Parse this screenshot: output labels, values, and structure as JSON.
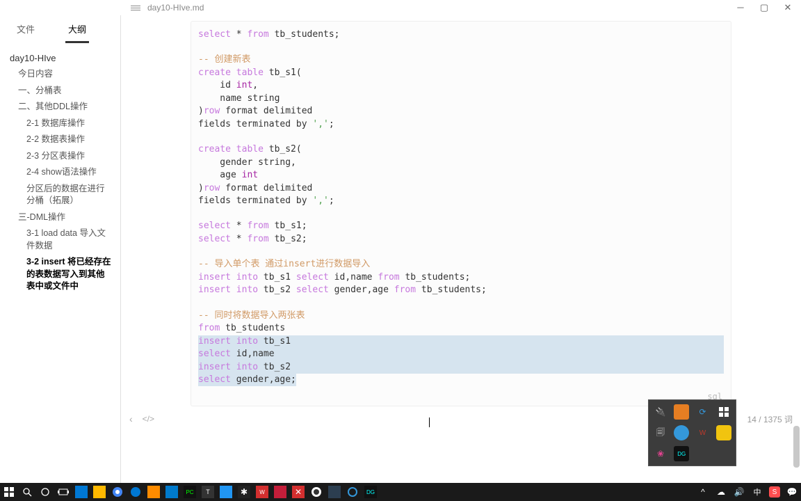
{
  "titlebar": {
    "filename": "day10-HIve.md"
  },
  "side_tabs": {
    "files": "文件",
    "outline": "大纲"
  },
  "outline": {
    "doc": "day10-HIve",
    "items": [
      {
        "label": "今日内容",
        "lvl": 1
      },
      {
        "label": "一、分桶表",
        "lvl": 1
      },
      {
        "label": "二、其他DDL操作",
        "lvl": 1
      },
      {
        "label": "2-1 数据库操作",
        "lvl": 2
      },
      {
        "label": "2-2 数据表操作",
        "lvl": 2
      },
      {
        "label": "2-3 分区表操作",
        "lvl": 2
      },
      {
        "label": "2-4 show语法操作",
        "lvl": 2
      },
      {
        "label": "分区后的数据在进行分桶（拓展）",
        "lvl": 2
      },
      {
        "label": "三-DML操作",
        "lvl": 1
      },
      {
        "label": "3-1 load data 导入文件数据",
        "lvl": 2
      },
      {
        "label": "3-2 insert 将已经存在的表数据写入到其他表中或文件中",
        "lvl": 2,
        "bold": true
      }
    ]
  },
  "code": {
    "lang": "sql",
    "c01a": "select",
    "c01b": " * ",
    "c01c": "from",
    "c01d": " tb_students;",
    "c03a": "-- ",
    "c03b": "创建新表",
    "c04a": "create table",
    "c04b": " tb_s1(",
    "c05a": "    id ",
    "c05b": "int",
    "c05c": ",",
    "c06a": "    name string",
    "c07a": ")",
    "c07b": "row",
    "c07c": " format delimited",
    "c08a": "fields terminated by ",
    "c08b": "','",
    "c08c": ";",
    "c10a": "create table",
    "c10b": " tb_s2(",
    "c11a": "    gender string,",
    "c12a": "    age ",
    "c12b": "int",
    "c13a": ")",
    "c13b": "row",
    "c13c": " format delimited",
    "c14a": "fields terminated by ",
    "c14b": "','",
    "c14c": ";",
    "c16a": "select",
    "c16b": " * ",
    "c16c": "from",
    "c16d": " tb_s1;",
    "c17a": "select",
    "c17b": " * ",
    "c17c": "from",
    "c17d": " tb_s2;",
    "c19a": "-- ",
    "c19b": "导入单个表 通过insert进行数据导入",
    "c20a": "insert into",
    "c20b": " tb_s1 ",
    "c20c": "select",
    "c20d": " id,name ",
    "c20e": "from",
    "c20f": " tb_students;",
    "c21a": "insert into",
    "c21b": " tb_s2 ",
    "c21c": "select",
    "c21d": " gender,age ",
    "c21e": "from",
    "c21f": " tb_students;",
    "c23a": "-- ",
    "c23b": "同时将数据导入两张表",
    "c24a": "from",
    "c24b": " tb_students",
    "c25a": "insert into",
    "c25b": " tb_s1",
    "c26a": "select",
    "c26b": " id,name",
    "c27a": "insert into",
    "c27b": " tb_s2",
    "c28a": "select",
    "c28b": " gender,age;"
  },
  "status": {
    "words": "14 / 1375 词"
  },
  "tray": {
    "colors": [
      "#888",
      "#e67e22",
      "#3498db",
      "#fff",
      "#888",
      "#3498db",
      "#c0392b",
      "#f1c40f",
      "#e84393",
      "#333"
    ]
  }
}
